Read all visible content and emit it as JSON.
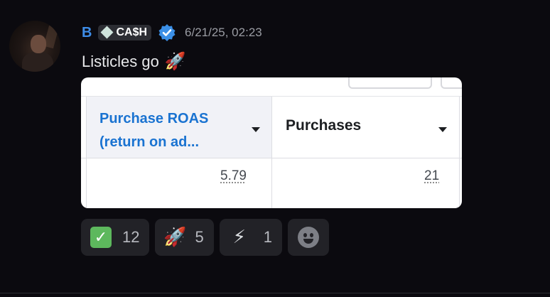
{
  "message": {
    "author": "B",
    "tag_label": "CA$H",
    "timestamp": "6/21/25, 02:23",
    "text": "Listicles go",
    "text_emoji": "🚀"
  },
  "embed": {
    "columns": [
      {
        "header": "Purchase ROAS (return on ad...",
        "value": "5.79"
      },
      {
        "header": "Purchases",
        "value": "21"
      }
    ]
  },
  "reactions": [
    {
      "emoji": "check-mark-icon",
      "count": "12"
    },
    {
      "emoji": "🚀",
      "count": "5"
    },
    {
      "emoji": "⚡",
      "count": "1"
    }
  ],
  "colors": {
    "username": "#3e8de8",
    "link_header": "#1a73d1",
    "background": "#0b0a0f"
  }
}
